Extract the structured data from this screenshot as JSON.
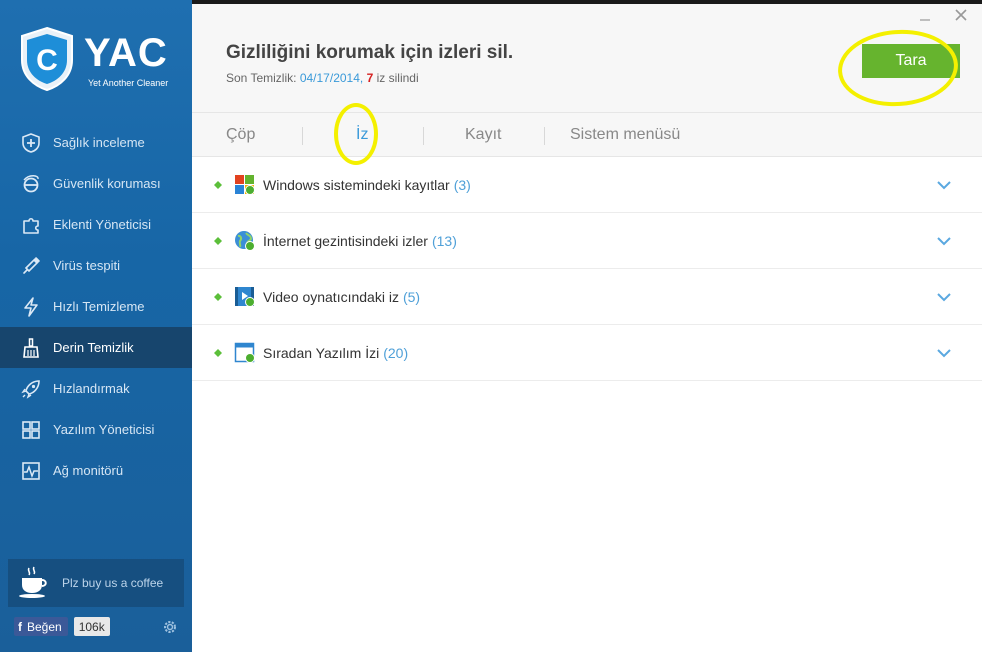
{
  "app": {
    "logo_text": "YAC",
    "logo_subtitle": "Yet Another Cleaner"
  },
  "sidebar": {
    "items": [
      {
        "label": "Sağlık inceleme",
        "icon": "shield-plus-icon",
        "active": false
      },
      {
        "label": "Güvenlik koruması",
        "icon": "ie-icon",
        "active": false
      },
      {
        "label": "Eklenti Yöneticisi",
        "icon": "puzzle-icon",
        "active": false
      },
      {
        "label": "Virüs tespiti",
        "icon": "syringe-icon",
        "active": false
      },
      {
        "label": "Hızlı Temizleme",
        "icon": "lightning-icon",
        "active": false
      },
      {
        "label": "Derin Temizlik",
        "icon": "broom-icon",
        "active": true
      },
      {
        "label": "Hızlandırmak",
        "icon": "rocket-icon",
        "active": false
      },
      {
        "label": "Yazılım Yöneticisi",
        "icon": "grid-icon",
        "active": false
      },
      {
        "label": "Ağ monitörü",
        "icon": "pulse-icon",
        "active": false
      }
    ],
    "coffee_label": "Plz buy us a coffee",
    "like_label": "Beğen",
    "like_count": "106k"
  },
  "header": {
    "title": "Gizliliğini korumak için izleri sil.",
    "last_clean_label": "Son Temizlik:",
    "last_clean_date": "04/17/2014",
    "comma": ",",
    "removed_count": "7",
    "removed_suffix": "iz silindi",
    "scan_button": "Tara"
  },
  "tabs": [
    {
      "label": "Çöp",
      "active": false
    },
    {
      "label": "İz",
      "active": true
    },
    {
      "label": "Kayıt",
      "active": false
    },
    {
      "label": "Sistem menüsü",
      "active": false
    }
  ],
  "rows": [
    {
      "label": "Windows sistemindeki kayıtlar",
      "count": "(3)",
      "icon": "windows-icon"
    },
    {
      "label": "İnternet gezintisindeki izler",
      "count": "(13)",
      "icon": "globe-icon"
    },
    {
      "label": "Video oynatıcındaki iz",
      "count": "(5)",
      "icon": "video-icon"
    },
    {
      "label": "Sıradan Yazılım İzi",
      "count": "(20)",
      "icon": "window-icon"
    }
  ],
  "colors": {
    "sidebar": "#1f6fb0",
    "sidebar_active": "#17456d",
    "accent_blue": "#3a9ad9",
    "scan_green": "#66b42e",
    "highlight": "#f4f000",
    "count_red": "#d62020"
  }
}
